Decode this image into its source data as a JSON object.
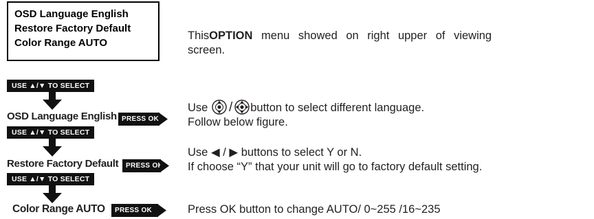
{
  "osd_box": {
    "lines": [
      "OSD Language English",
      "Restore Factory Default",
      "Color Range AUTO"
    ]
  },
  "description": {
    "part1": "This ",
    "bold": "OPTION",
    "part2": " menu showed on right upper of viewing",
    "line2": "screen."
  },
  "select_tag": {
    "label": "USE ▲/▼ TO SELECT"
  },
  "press_ok_label": "PRESS OK",
  "steps": [
    {
      "label": "OSD Language English",
      "icon": "direction-button-icons"
    },
    {
      "label": "Restore Factory Default"
    },
    {
      "label": "Color Range AUTO"
    }
  ],
  "instructions": {
    "language": {
      "pre": "Use ",
      "separator": "/",
      "post": "button to select different language.",
      "line2": "Follow below figure."
    },
    "restore": {
      "pre": "Use ",
      "left_icon": "◀",
      "separator": " / ",
      "right_icon": "▶",
      "post": " buttons to select Y or N.",
      "line2": "If choose “Y” that your unit will go to factory default setting."
    },
    "color": {
      "text": "Press OK button to change AUTO/ 0~255 /16~235"
    }
  },
  "colors": {
    "text": "#231f20",
    "tag_bg": "#111111",
    "tag_text": "#ffffff"
  }
}
